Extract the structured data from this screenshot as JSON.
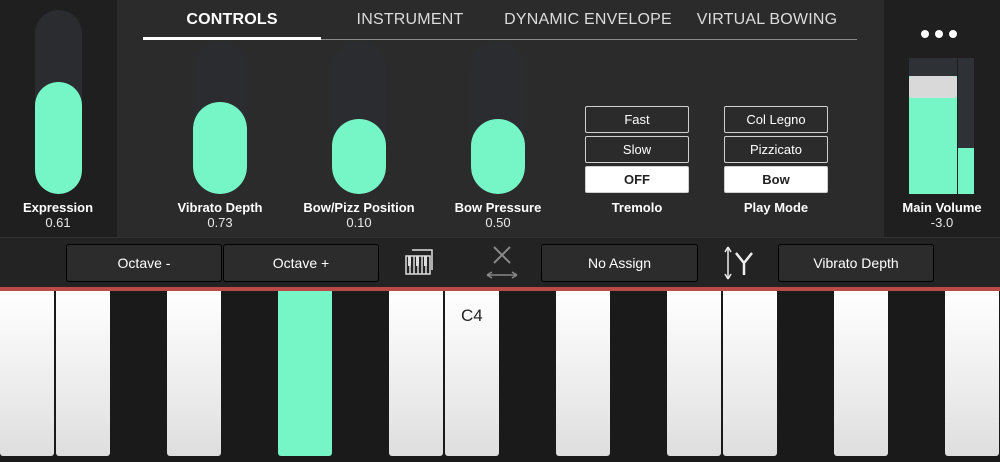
{
  "tabs": [
    {
      "label": "CONTROLS",
      "active": true
    },
    {
      "label": "INSTRUMENT",
      "active": false
    },
    {
      "label": "DYNAMIC ENVELOPE",
      "active": false
    },
    {
      "label": "VIRTUAL BOWING",
      "active": false
    }
  ],
  "sliders": {
    "expression": {
      "label": "Expression",
      "value": "0.61"
    },
    "vibrato_depth": {
      "label": "Vibrato Depth",
      "value": "0.73"
    },
    "bow_pizz_position": {
      "label": "Bow/Pizz Position",
      "value": "0.10"
    },
    "bow_pressure": {
      "label": "Bow Pressure",
      "value": "0.50"
    }
  },
  "tremolo": {
    "label": "Tremolo",
    "options": [
      "Fast",
      "Slow",
      "OFF"
    ],
    "selected": "OFF"
  },
  "play_mode": {
    "label": "Play Mode",
    "options": [
      "Col Legno",
      "Pizzicato",
      "Bow"
    ],
    "selected": "Bow"
  },
  "main_volume": {
    "label": "Main Volume",
    "value": "-3.0"
  },
  "menu_icon": "more-dots-icon",
  "bottom_bar": {
    "octave_down": "Octave -",
    "octave_up": "Octave +",
    "x_assign": "No Assign",
    "y_assign": "Vibrato Depth"
  },
  "keyboard": {
    "label": "C4"
  },
  "colors": {
    "accent": "#76f5c6",
    "background": "#2b2b2b",
    "red_line": "#b94a48"
  }
}
